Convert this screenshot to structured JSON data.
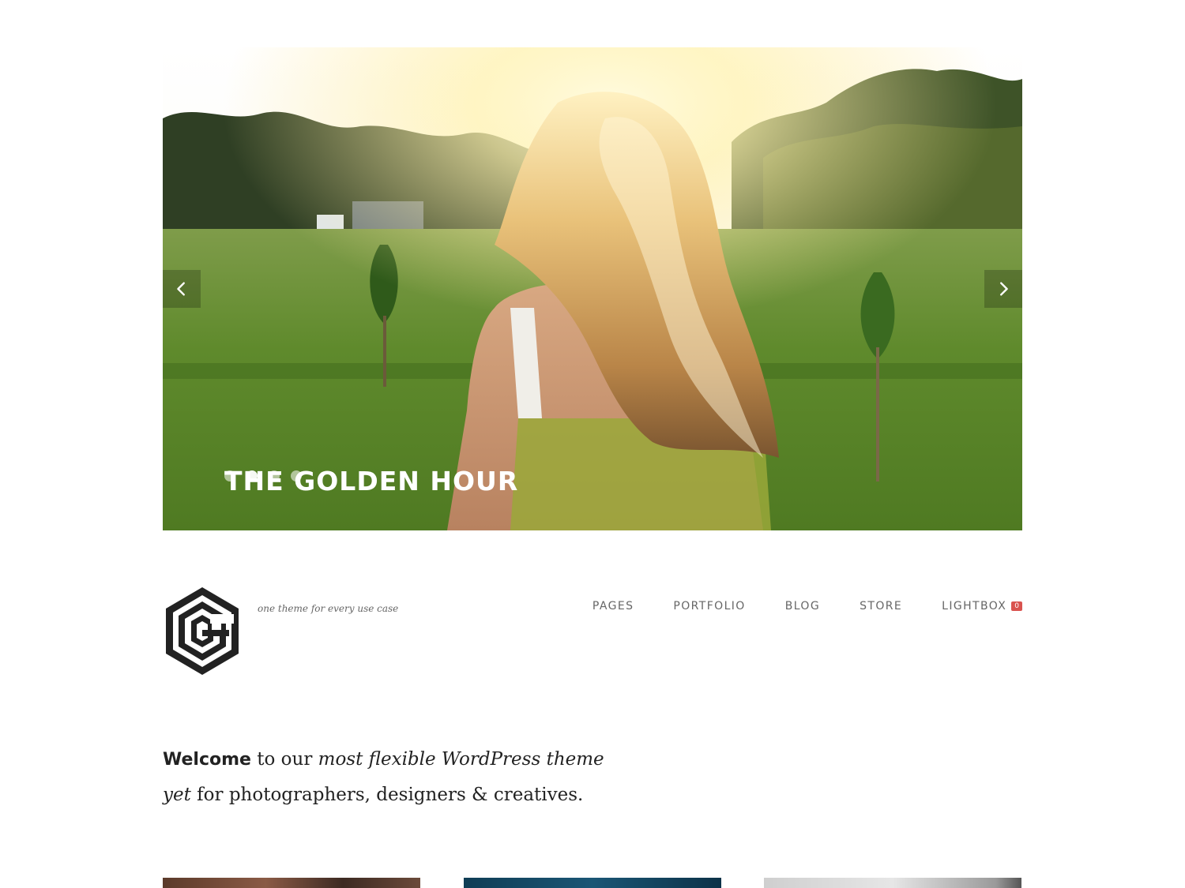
{
  "slider": {
    "title": "THE GOLDEN HOUR",
    "slide_count": 4,
    "active_slide": 2,
    "prev_icon": "chevron-left-icon",
    "next_icon": "chevron-right-icon"
  },
  "header": {
    "logo_icon": "hexagon-g-logo-icon",
    "tagline": "one theme for every use case",
    "nav": [
      {
        "label": "PAGES"
      },
      {
        "label": "PORTFOLIO"
      },
      {
        "label": "BLOG"
      },
      {
        "label": "STORE"
      },
      {
        "label": "LIGHTBOX",
        "badge": "0"
      }
    ]
  },
  "intro": {
    "strong": "Welcome",
    "part1": " to our ",
    "em": "most flexible WordPress theme yet",
    "part2": " for photographers, designers & creatives."
  },
  "colors": {
    "badge": "#d9534f",
    "nav_text": "#666666",
    "body_text": "#222222"
  }
}
